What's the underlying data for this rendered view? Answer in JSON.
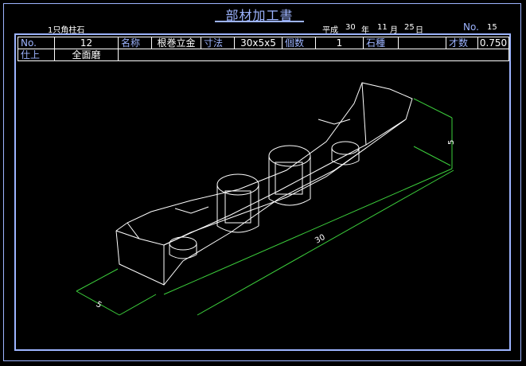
{
  "sheet": {
    "title": "部材加工書",
    "project": "1只角柱石",
    "era": "平成",
    "year": "30",
    "year_unit": "年",
    "month": "11",
    "month_unit": "月",
    "day": "25",
    "day_unit": "日",
    "sheet_no_label": "No.",
    "sheet_no": "15"
  },
  "row1": {
    "no_label": "No.",
    "no_value": "12",
    "name_label": "名称",
    "name_value": "根巻立金",
    "size_label": "寸法",
    "size_value": "30x5x5",
    "count_label": "個数",
    "count_value": "1",
    "stone_label": "石種",
    "stone_value": "",
    "volume_label": "才数",
    "volume_value": "0.750"
  },
  "row2": {
    "finish_label": "仕上",
    "finish_value": "全面磨"
  },
  "drawing": {
    "dim_length": "30",
    "dim_width": "5",
    "dim_height": "5"
  },
  "colors": {
    "frame": "#9db4ff",
    "lines": "#ffffff",
    "dimension": "#3ccf3c",
    "background": "#000000"
  }
}
